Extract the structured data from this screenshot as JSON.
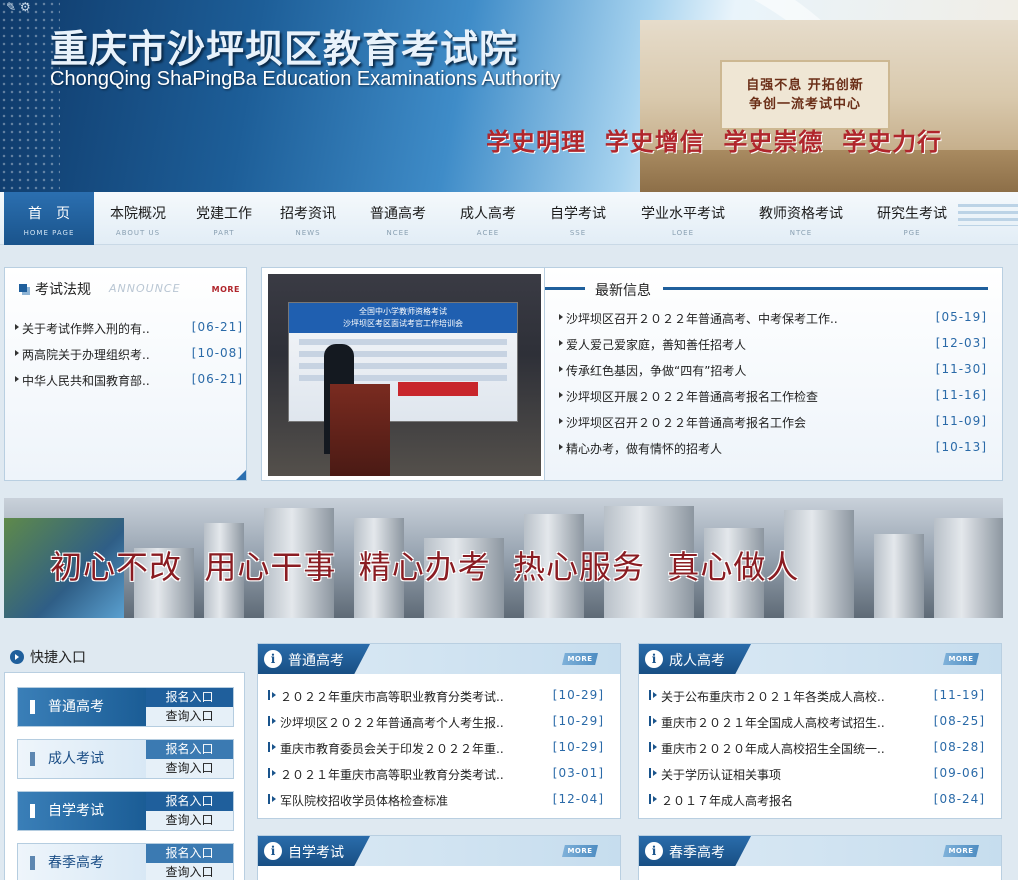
{
  "header": {
    "title_cn": "重庆市沙坪坝区教育考试院",
    "title_en": "ChongQing ShaPingBa Education Examinations Authority",
    "slogan": "学史明理  学史增信  学史崇德  学史力行",
    "wall_text": "自强不息 开拓创新\n争创一流考试中心"
  },
  "nav": [
    {
      "cn": "首　页",
      "en": "HOME PAGE"
    },
    {
      "cn": "本院概况",
      "en": "ABOUT US"
    },
    {
      "cn": "党建工作",
      "en": "PART"
    },
    {
      "cn": "招考资讯",
      "en": "NEWS"
    },
    {
      "cn": "普通高考",
      "en": "NCEE"
    },
    {
      "cn": "成人高考",
      "en": "ACEE"
    },
    {
      "cn": "自学考试",
      "en": "SSE"
    },
    {
      "cn": "学业水平考试",
      "en": "LOEE"
    },
    {
      "cn": "教师资格考试",
      "en": "NTCE"
    },
    {
      "cn": "研究生考试",
      "en": "PGE"
    }
  ],
  "law": {
    "title": "考试法规",
    "subtitle": "ANNOUNCE",
    "more": "MORE",
    "items": [
      {
        "text": "关于考试作弊入刑的有..",
        "date": "[06-21]"
      },
      {
        "text": "两高院关于办理组织考..",
        "date": "[10-08]"
      },
      {
        "text": "中华人民共和国教育部..",
        "date": "[06-21]"
      }
    ]
  },
  "photo": {
    "screen_title": "全国中小学教师资格考试\n沙坪坝区考区面试考官工作培训会"
  },
  "news": {
    "title": "最新信息",
    "items": [
      {
        "text": "沙坪坝区召开２０２２年普通高考、中考保考工作..",
        "date": "[05-19]"
      },
      {
        "text": "爱人爱己爱家庭，善知善任招考人",
        "date": "[12-03]"
      },
      {
        "text": "传承红色基因，争做“四有”招考人",
        "date": "[11-30]"
      },
      {
        "text": "沙坪坝区开展２０２２年普通高考报名工作检查",
        "date": "[11-16]"
      },
      {
        "text": "沙坪坝区召开２０２２年普通高考报名工作会",
        "date": "[11-09]"
      },
      {
        "text": "精心办考，做有情怀的招考人",
        "date": "[10-13]"
      }
    ]
  },
  "slogan_banner": "初心不改  用心干事  精心办考  热心服务  真心做人",
  "quick": {
    "title": "快捷入口",
    "entries": [
      {
        "name": "普通高考",
        "link1": "报名入口",
        "link2": "查询入口"
      },
      {
        "name": "成人考试",
        "link1": "报名入口",
        "link2": "查询入口"
      },
      {
        "name": "自学考试",
        "link1": "报名入口",
        "link2": "查询入口"
      },
      {
        "name": "春季高考",
        "link1": "报名入口",
        "link2": "查询入口"
      }
    ]
  },
  "sections": {
    "more": "MORE",
    "gaokao": {
      "title": "普通高考",
      "items": [
        {
          "text": "２０２２年重庆市高等职业教育分类考试..",
          "date": "[10-29]"
        },
        {
          "text": "沙坪坝区２０２２年普通高考个人考生报..",
          "date": "[10-29]"
        },
        {
          "text": "重庆市教育委员会关于印发２０２２年重..",
          "date": "[10-29]"
        },
        {
          "text": "２０２１年重庆市高等职业教育分类考试..",
          "date": "[03-01]"
        },
        {
          "text": "军队院校招收学员体格检查标准",
          "date": "[12-04]"
        }
      ]
    },
    "chengren": {
      "title": "成人高考",
      "items": [
        {
          "text": "关于公布重庆市２０２１年各类成人高校..",
          "date": "[11-19]"
        },
        {
          "text": "重庆市２０２１年全国成人高校考试招生..",
          "date": "[08-25]"
        },
        {
          "text": "重庆市２０２０年成人高校招生全国统一..",
          "date": "[08-28]"
        },
        {
          "text": "关于学历认证相关事项",
          "date": "[09-06]"
        },
        {
          "text": "２０１７年成人高考报名",
          "date": "[08-24]"
        }
      ]
    },
    "zixue": {
      "title": "自学考试"
    },
    "chunji": {
      "title": "春季高考"
    }
  }
}
